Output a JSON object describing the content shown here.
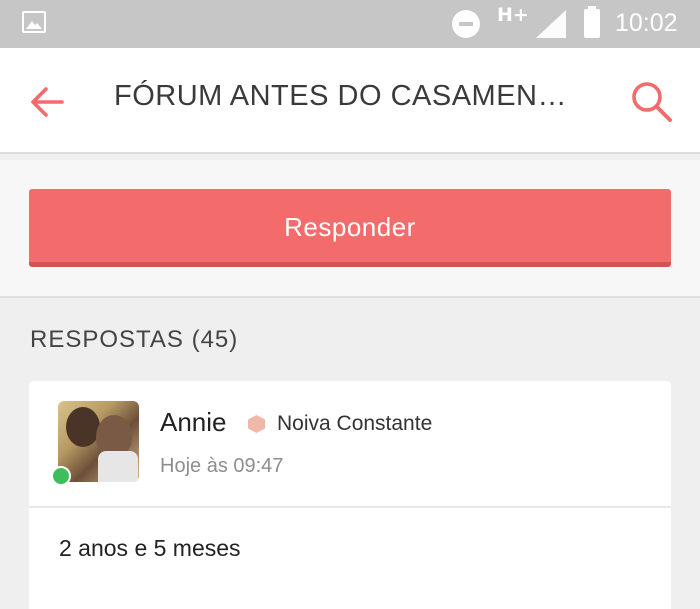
{
  "status_bar": {
    "network": "H+",
    "time": "10:02",
    "icons": [
      "image-icon",
      "do-not-disturb-icon",
      "signal-icon",
      "battery-icon"
    ]
  },
  "app_bar": {
    "title": "FÓRUM ANTES DO CASAMEN…",
    "back_icon": "back-arrow-icon",
    "search_icon": "search-icon",
    "accent_color": "#f36b6b"
  },
  "respond": {
    "label": "Responder",
    "color": "#f36b6b"
  },
  "replies": {
    "title": "RESPOSTAS (45)",
    "items": [
      {
        "author": "Annie",
        "rank": "Noiva Constante",
        "time": "Hoje às 09:47",
        "online": true,
        "body": "2 anos e 5 meses"
      }
    ]
  }
}
